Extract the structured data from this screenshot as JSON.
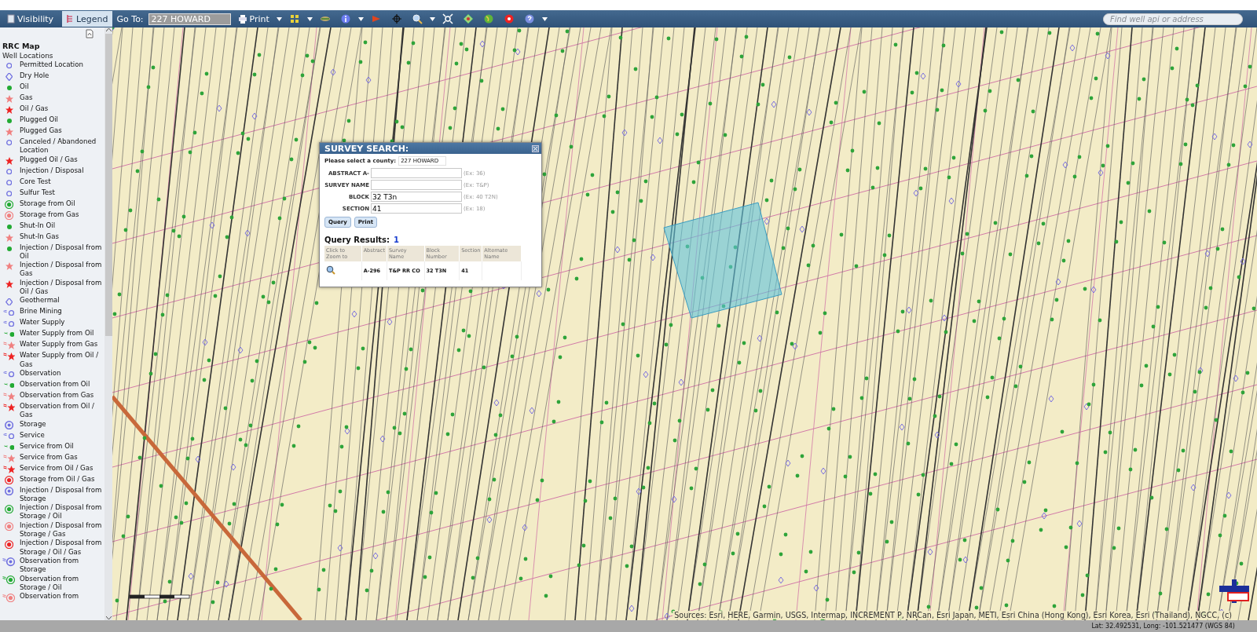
{
  "toolbar": {
    "tabs": [
      {
        "label": "Visibility",
        "selected": false
      },
      {
        "label": "Legend",
        "selected": true
      }
    ],
    "goto_label": "Go To:",
    "goto_value": "227 HOWARD",
    "print_label": "Print",
    "search": {
      "placeholder": "Find well api or address"
    }
  },
  "sidebar": {
    "title": "RRC Map",
    "group": "Well Locations",
    "items": [
      {
        "label": "Permitted Location",
        "kind": "ring",
        "color": "#7070e0"
      },
      {
        "label": "Dry Hole",
        "kind": "diamond",
        "color": "#7070e0"
      },
      {
        "label": "Oil",
        "kind": "dot",
        "color": "#22aa33"
      },
      {
        "label": "Gas",
        "kind": "star",
        "color": "#f08080"
      },
      {
        "label": "Oil / Gas",
        "kind": "star",
        "color": "#ee2222"
      },
      {
        "label": "Plugged Oil",
        "kind": "dot",
        "color": "#22aa33"
      },
      {
        "label": "Plugged Gas",
        "kind": "star",
        "color": "#f08080"
      },
      {
        "label": "Canceled / Abandoned Location",
        "kind": "ring",
        "color": "#7070e0"
      },
      {
        "label": "Plugged Oil / Gas",
        "kind": "star",
        "color": "#ee2222"
      },
      {
        "label": "Injection / Disposal",
        "kind": "ring",
        "color": "#7070e0"
      },
      {
        "label": "Core Test",
        "kind": "ring",
        "color": "#7070e0"
      },
      {
        "label": "Sulfur Test",
        "kind": "ring",
        "color": "#7070e0"
      },
      {
        "label": "Storage from Oil",
        "kind": "ring-dot",
        "color": "#22aa33"
      },
      {
        "label": "Storage from Gas",
        "kind": "ring-dot",
        "color": "#f08080"
      },
      {
        "label": "Shut-In Oil",
        "kind": "dot",
        "color": "#22aa33"
      },
      {
        "label": "Shut-In Gas",
        "kind": "star",
        "color": "#f08080"
      },
      {
        "label": "Injection / Disposal from Oil",
        "kind": "dot",
        "color": "#22aa33"
      },
      {
        "label": "Injection / Disposal from Gas",
        "kind": "star",
        "color": "#f08080"
      },
      {
        "label": "Injection / Disposal from Oil / Gas",
        "kind": "star",
        "color": "#ee2222"
      },
      {
        "label": "Geothermal",
        "kind": "diamond",
        "color": "#7070e0"
      },
      {
        "label": "Brine Mining",
        "kind": "flag-ring",
        "color": "#7070e0"
      },
      {
        "label": "Water Supply",
        "kind": "flag-ring",
        "color": "#7070e0"
      },
      {
        "label": "Water Supply from Oil",
        "kind": "flag-dot",
        "color": "#22aa33"
      },
      {
        "label": "Water Supply from Gas",
        "kind": "flag-star",
        "color": "#f08080"
      },
      {
        "label": "Water Supply from Oil / Gas",
        "kind": "flag-star",
        "color": "#ee2222"
      },
      {
        "label": "Observation",
        "kind": "flag-ring",
        "color": "#7070e0"
      },
      {
        "label": "Observation from Oil",
        "kind": "flag-dot",
        "color": "#22aa33"
      },
      {
        "label": "Observation from Gas",
        "kind": "flag-star",
        "color": "#f08080"
      },
      {
        "label": "Observation from Oil / Gas",
        "kind": "flag-star",
        "color": "#ee2222"
      },
      {
        "label": "Storage",
        "kind": "double-ring",
        "color": "#7070e0"
      },
      {
        "label": "Service",
        "kind": "flag-ring",
        "color": "#7070e0"
      },
      {
        "label": "Service from Oil",
        "kind": "flag-dot",
        "color": "#22aa33"
      },
      {
        "label": "Service from Gas",
        "kind": "flag-star",
        "color": "#f08080"
      },
      {
        "label": "Service from Oil / Gas",
        "kind": "flag-star",
        "color": "#ee2222"
      },
      {
        "label": "Storage from Oil / Gas",
        "kind": "ring-dot",
        "color": "#ee2222"
      },
      {
        "label": "Injection / Disposal from Storage",
        "kind": "double-ring",
        "color": "#7070e0"
      },
      {
        "label": "Injection / Disposal from Storage / Oil",
        "kind": "ring-dot",
        "color": "#22aa33"
      },
      {
        "label": "Injection / Disposal from Storage / Gas",
        "kind": "ring-dot",
        "color": "#f08080"
      },
      {
        "label": "Injection / Disposal from Storage / Oil / Gas",
        "kind": "ring-dot",
        "color": "#ee2222"
      },
      {
        "label": "Observation from Storage",
        "kind": "flag-double-ring",
        "color": "#7070e0"
      },
      {
        "label": "Observation from Storage / Oil",
        "kind": "flag-ring-dot",
        "color": "#22aa33"
      },
      {
        "label": "Observation from",
        "kind": "flag-ring-dot",
        "color": "#f08080"
      }
    ]
  },
  "dialog": {
    "title": "SURVEY SEARCH:",
    "county_label": "Please select a county:",
    "county_value": "227 HOWARD",
    "fields": [
      {
        "label": "ABSTRACT A-",
        "hint": "(Ex: 36)"
      },
      {
        "label": "SURVEY NAME",
        "hint": "(Ex: T&P)"
      },
      {
        "label": "BLOCK",
        "value": "32 T3n",
        "hint": "(Ex: 40 T2N)"
      },
      {
        "label": "SECTION",
        "value": "41",
        "hint": "(Ex: 18)"
      }
    ],
    "buttons": [
      "Query",
      "Print"
    ],
    "results_label": "Query Results:",
    "results_count": "1",
    "table": {
      "columns": [
        "Click to Zoom to",
        "Abstract",
        "Survey Name",
        "Block Number",
        "Section",
        "Alternate Name"
      ],
      "rows": [
        [
          "",
          "A-296",
          "T&P RR CO",
          "32 T3N",
          "41",
          ""
        ]
      ]
    }
  },
  "map": {
    "attribution": "Sources: Esri, HERE, Garmin, USGS, Intermap, INCREMENT P, NRCan, Esri Japan, METI, Esri China (Hong Kong), Esri Korea, Esri (Thailand), NGCC, (c)"
  },
  "status_bar": "Lat: 32.492531, Long: -101.521477 (WGS 84)"
}
